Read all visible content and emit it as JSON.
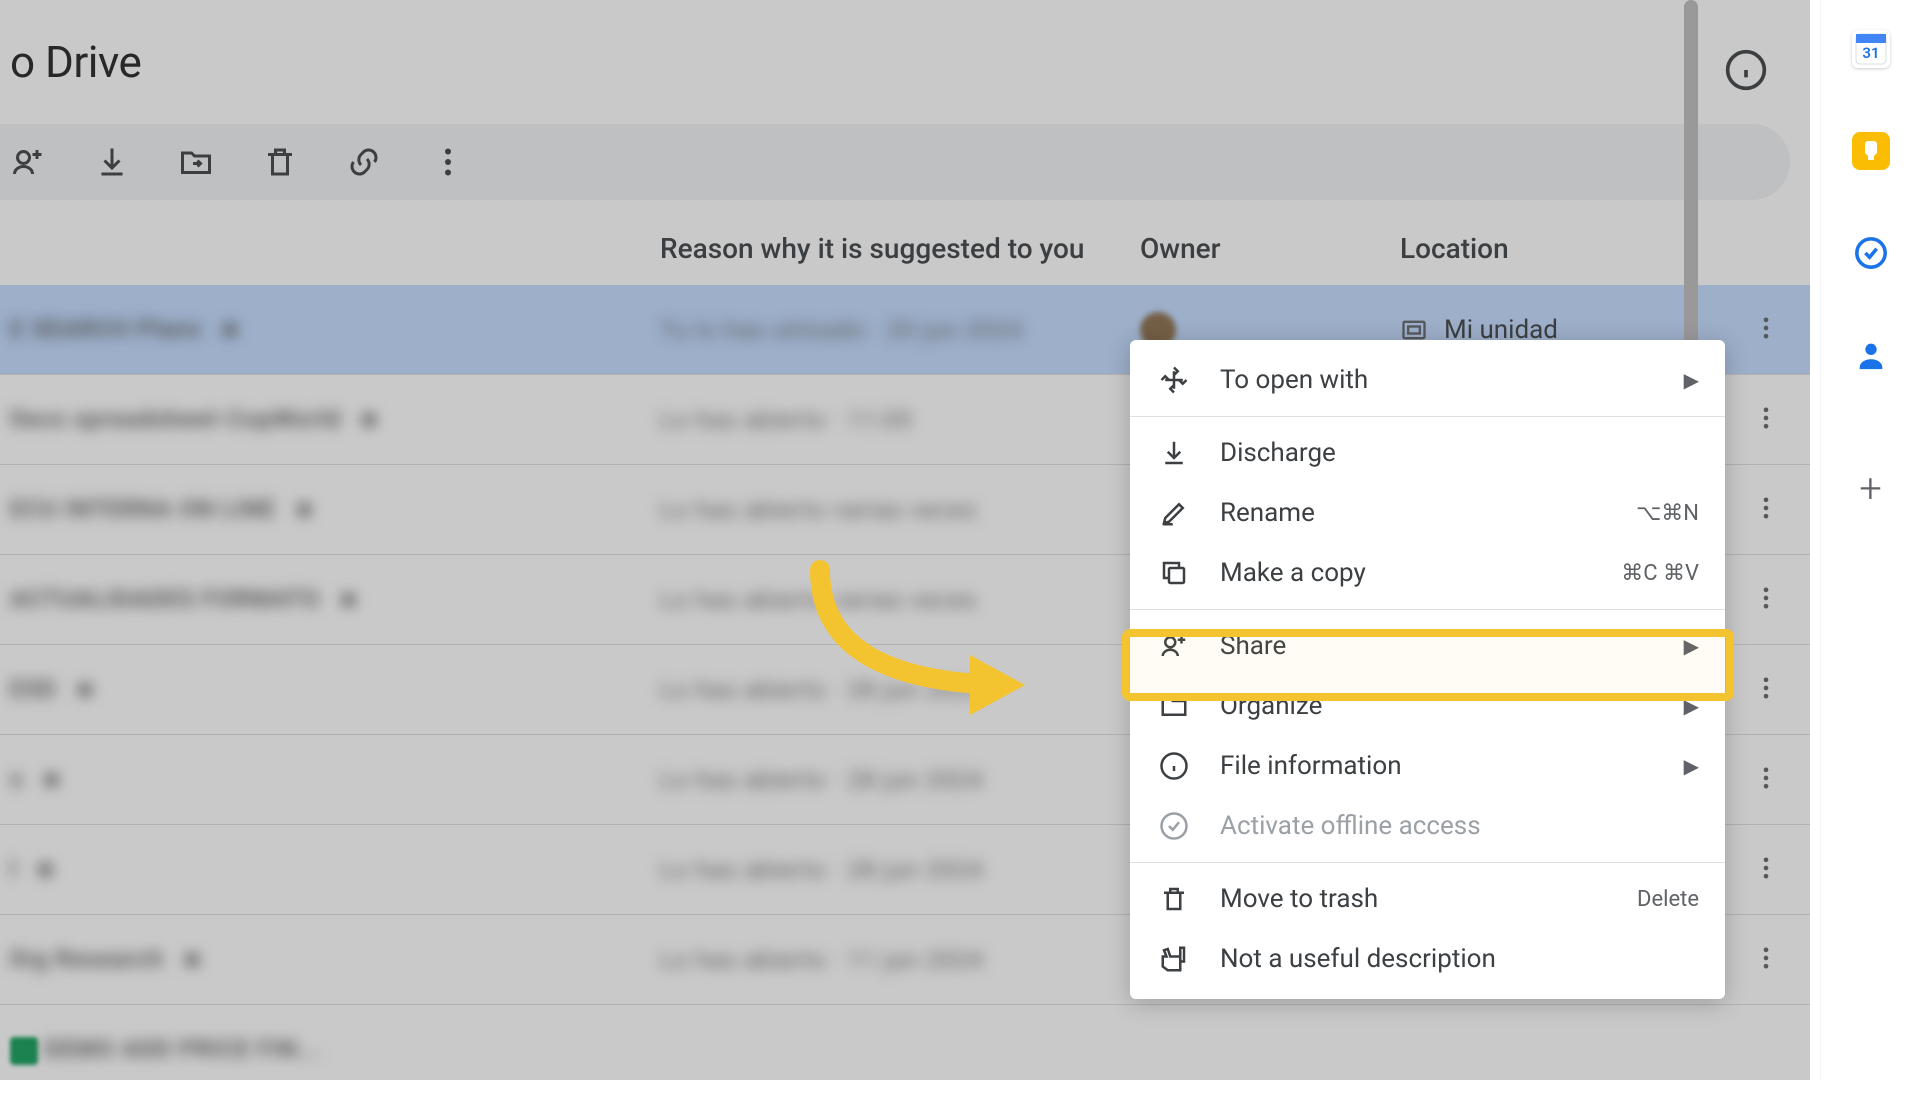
{
  "page_title": "o Drive",
  "columns": {
    "reason": "Reason why it is suggested to you",
    "owner": "Owner",
    "location": "Location"
  },
  "selected_row": {
    "location": "Mi unidad"
  },
  "context_menu": {
    "open_with": "To open with",
    "download": "Discharge",
    "rename": "Rename",
    "rename_shortcut": "⌥⌘N",
    "make_copy": "Make a copy",
    "make_copy_shortcut": "⌘C ⌘V",
    "share": "Share",
    "organize": "Organize",
    "file_info": "File information",
    "offline": "Activate offline access",
    "trash": "Move to trash",
    "trash_shortcut": "Delete",
    "not_useful": "Not a useful description"
  },
  "rail": {
    "calendar_day": "31"
  },
  "highlight_color": "#f4c430"
}
